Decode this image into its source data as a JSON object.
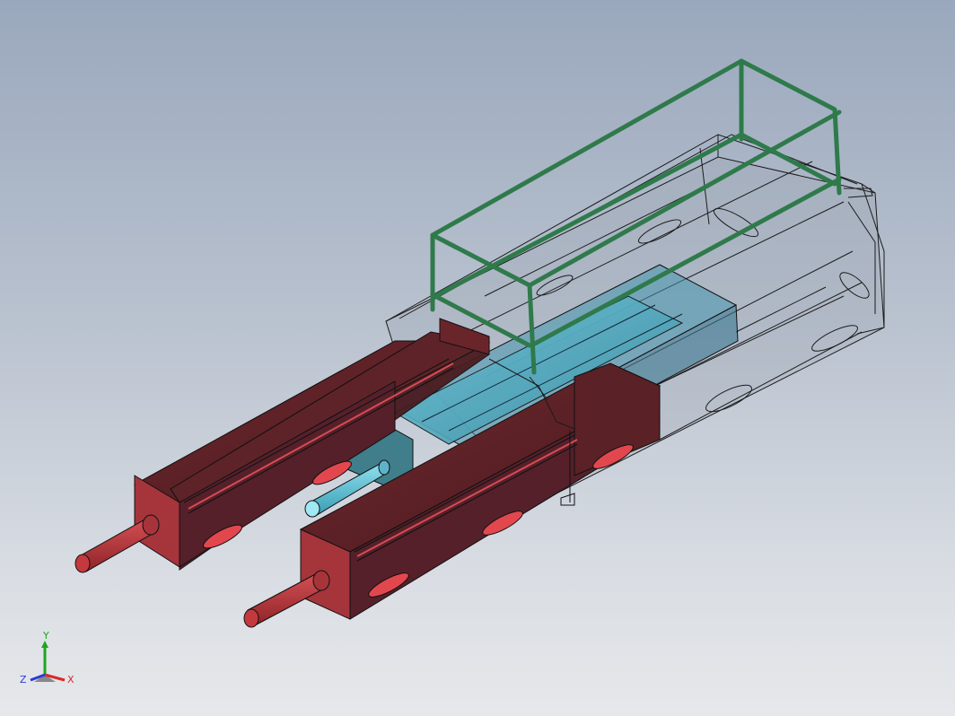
{
  "viewport": {
    "background_top": "#9aa8bd",
    "background_bottom": "#e6e8eb"
  },
  "triad": {
    "x_label": "X",
    "y_label": "Y",
    "z_label": "Z",
    "x_color": "#d82a2a",
    "y_color": "#1fa51f",
    "z_color": "#2a3ad8"
  },
  "colors": {
    "red_body": "#5a2126",
    "red_face": "#a9353b",
    "red_slot": "#e2474e",
    "rod_red": "#b83438",
    "cyan": "#5fb3c8",
    "teal_plate": "#3e7a86",
    "green_rail": "#2f7a4b",
    "wire": "#111111"
  }
}
